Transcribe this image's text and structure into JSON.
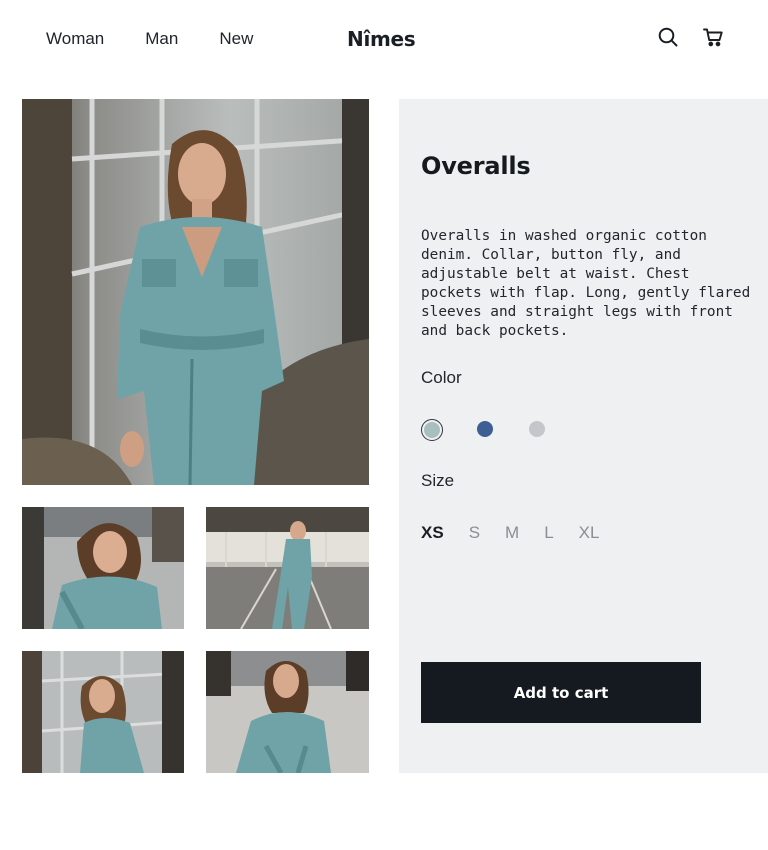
{
  "header": {
    "nav": [
      "Woman",
      "Man",
      "New"
    ],
    "brand": "Nîmes",
    "icons": [
      "search-icon",
      "cart-icon"
    ]
  },
  "gallery": {
    "main": "model-full-overalls-photo",
    "thumbnails": [
      "model-crouching-photo",
      "model-parking-garage-photo",
      "model-window-photo",
      "model-squatting-photo"
    ]
  },
  "product": {
    "title": "Overalls",
    "description": "Overalls in washed organic cotton denim. Collar, button fly, and adjustable belt at waist. Chest pockets with flap. Long, gently flared sleeves and straight legs with front and back pockets.",
    "color_label": "Color",
    "colors": [
      "#a9bfbf",
      "#3d5f93",
      "#c4c6c9"
    ],
    "selected_color": "#a9bfbf",
    "size_label": "Size",
    "sizes": [
      "XS",
      "S",
      "M",
      "L",
      "XL"
    ],
    "selected_size": "XS",
    "add_to_cart": "Add to cart"
  },
  "theme": {
    "panel_bg": "#eff0f2",
    "button_bg": "#141a1f",
    "denim": "#6fa3a7"
  }
}
